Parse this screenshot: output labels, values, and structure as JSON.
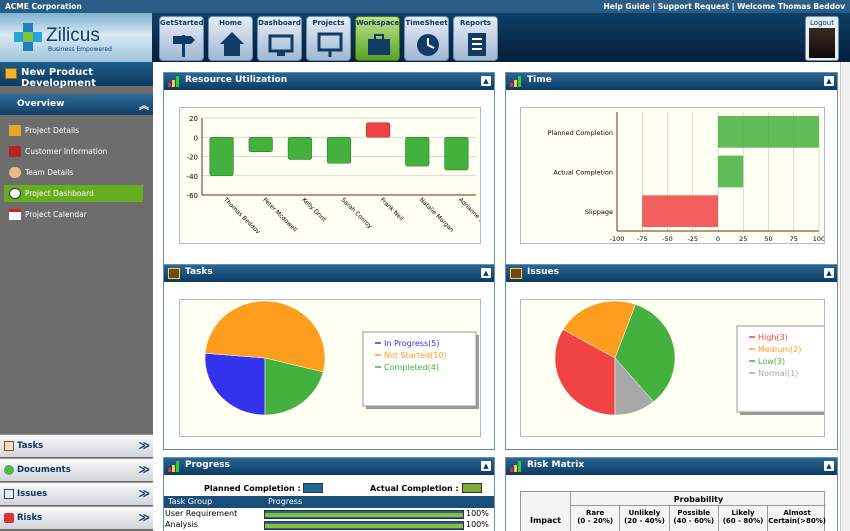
{
  "topbar": {
    "org": "ACME Corporation",
    "links": "Help Guide | Support Request | Welcome Thomas Beddov"
  },
  "logo": {
    "brand": "Zilicus",
    "tagline": "Business Empowered"
  },
  "nav": [
    {
      "label": "GetStarted"
    },
    {
      "label": "Home"
    },
    {
      "label": "Dashboard"
    },
    {
      "label": "Projects"
    },
    {
      "label": "Workspace"
    },
    {
      "label": "TimeSheet"
    },
    {
      "label": "Reports"
    }
  ],
  "logout": "Logout",
  "sidebar": {
    "project": "New Product Development",
    "overview": "Overview",
    "items": [
      {
        "label": "Project Details"
      },
      {
        "label": "Customer Information"
      },
      {
        "label": "Team Details"
      },
      {
        "label": "Project Dashboard"
      },
      {
        "label": "Project Calendar"
      }
    ],
    "accordion": [
      {
        "label": "Tasks"
      },
      {
        "label": "Documents"
      },
      {
        "label": "Issues"
      },
      {
        "label": "Risks"
      }
    ]
  },
  "colors": {
    "green": "#44b13f",
    "red": "#f04444",
    "orange": "#ff9d1f",
    "blue": "#3333ee",
    "gray": "#a8a8a8",
    "header": "#0a3a64"
  },
  "panels": {
    "resource": {
      "title": "Resource Utilization"
    },
    "time": {
      "title": "Time"
    },
    "tasks": {
      "title": "Tasks",
      "legend": [
        "In Progress(5)",
        "Not Started(10)",
        "Completed(4)"
      ]
    },
    "issues": {
      "title": "Issues",
      "legend": [
        "High(3)",
        "Medium(2)",
        "Low(3)",
        "Normal(1)"
      ]
    },
    "progress": {
      "title": "Progress",
      "planned": "Planned Completion :",
      "actual": "Actual Completion :",
      "col1": "Task Group",
      "col2": "Progress",
      "rows": [
        {
          "group": "User Requirement",
          "pct": "100%"
        },
        {
          "group": "Analysis",
          "pct": "100%"
        }
      ]
    },
    "risk": {
      "title": "Risk Matrix",
      "probability": "Probability",
      "impact": "Impact",
      "cols": [
        {
          "name": "Rare",
          "range": "(0 - 20%)"
        },
        {
          "name": "Unlikely",
          "range": "(20 - 40%)"
        },
        {
          "name": "Possible",
          "range": "(40 - 60%)"
        },
        {
          "name": "Likely",
          "range": "(60 - 80%)"
        },
        {
          "name": "Almost",
          "range": "Certain(>80%)"
        }
      ]
    }
  },
  "chart_data": [
    {
      "type": "bar",
      "categories": [
        "Thomas Beddov",
        "Peter Mcdowell",
        "Kelly  Grint",
        "Sarah Conroy",
        "Frank Neil",
        "Natalie Morgan",
        "Adrianne Broom"
      ],
      "values": [
        -40,
        -15,
        -23,
        -27,
        15,
        -30,
        -34
      ],
      "ylim": [
        -60,
        20
      ],
      "yticks": [
        20,
        0,
        -20,
        -40,
        -60
      ],
      "xlabel": "",
      "ylabel": ""
    },
    {
      "type": "bar",
      "orientation": "horizontal",
      "categories": [
        "Planned Completion",
        "Actual Completion",
        "Slippage"
      ],
      "values": [
        100,
        25,
        -75
      ],
      "xlim": [
        -100,
        100
      ],
      "xticks": [
        -100,
        -75,
        -50,
        -25,
        0,
        25,
        50,
        75,
        100
      ]
    },
    {
      "type": "pie",
      "labels": [
        "In Progress",
        "Not Started",
        "Completed"
      ],
      "values": [
        5,
        10,
        4
      ]
    },
    {
      "type": "pie",
      "labels": [
        "High",
        "Medium",
        "Low",
        "Normal"
      ],
      "values": [
        3,
        2,
        3,
        1
      ]
    }
  ]
}
